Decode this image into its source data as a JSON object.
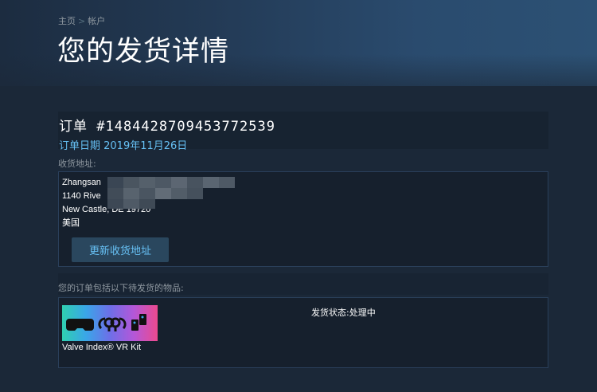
{
  "breadcrumb": {
    "home": "主页",
    "separator": ">",
    "account": "帐户"
  },
  "page": {
    "title": "您的发货详情"
  },
  "order": {
    "number": "订单 #1484428709453772539",
    "date": "订单日期 2019年11月26日"
  },
  "shipping": {
    "label": "收货地址:",
    "address_lines": [
      "Zhangsan",
      "1140 Rive",
      "New Castle, DE 19720",
      "美国"
    ],
    "update_button": "更新收货地址"
  },
  "items": {
    "label": "您的订单包括以下待发货的物品:",
    "list": [
      {
        "name": "Valve Index® VR Kit",
        "status": "发货状态:处理中"
      }
    ]
  },
  "colors": {
    "background": "#1b2838",
    "accent": "#66c0f4",
    "button_bg": "#2a475e",
    "button_text": "#67c1f5"
  }
}
